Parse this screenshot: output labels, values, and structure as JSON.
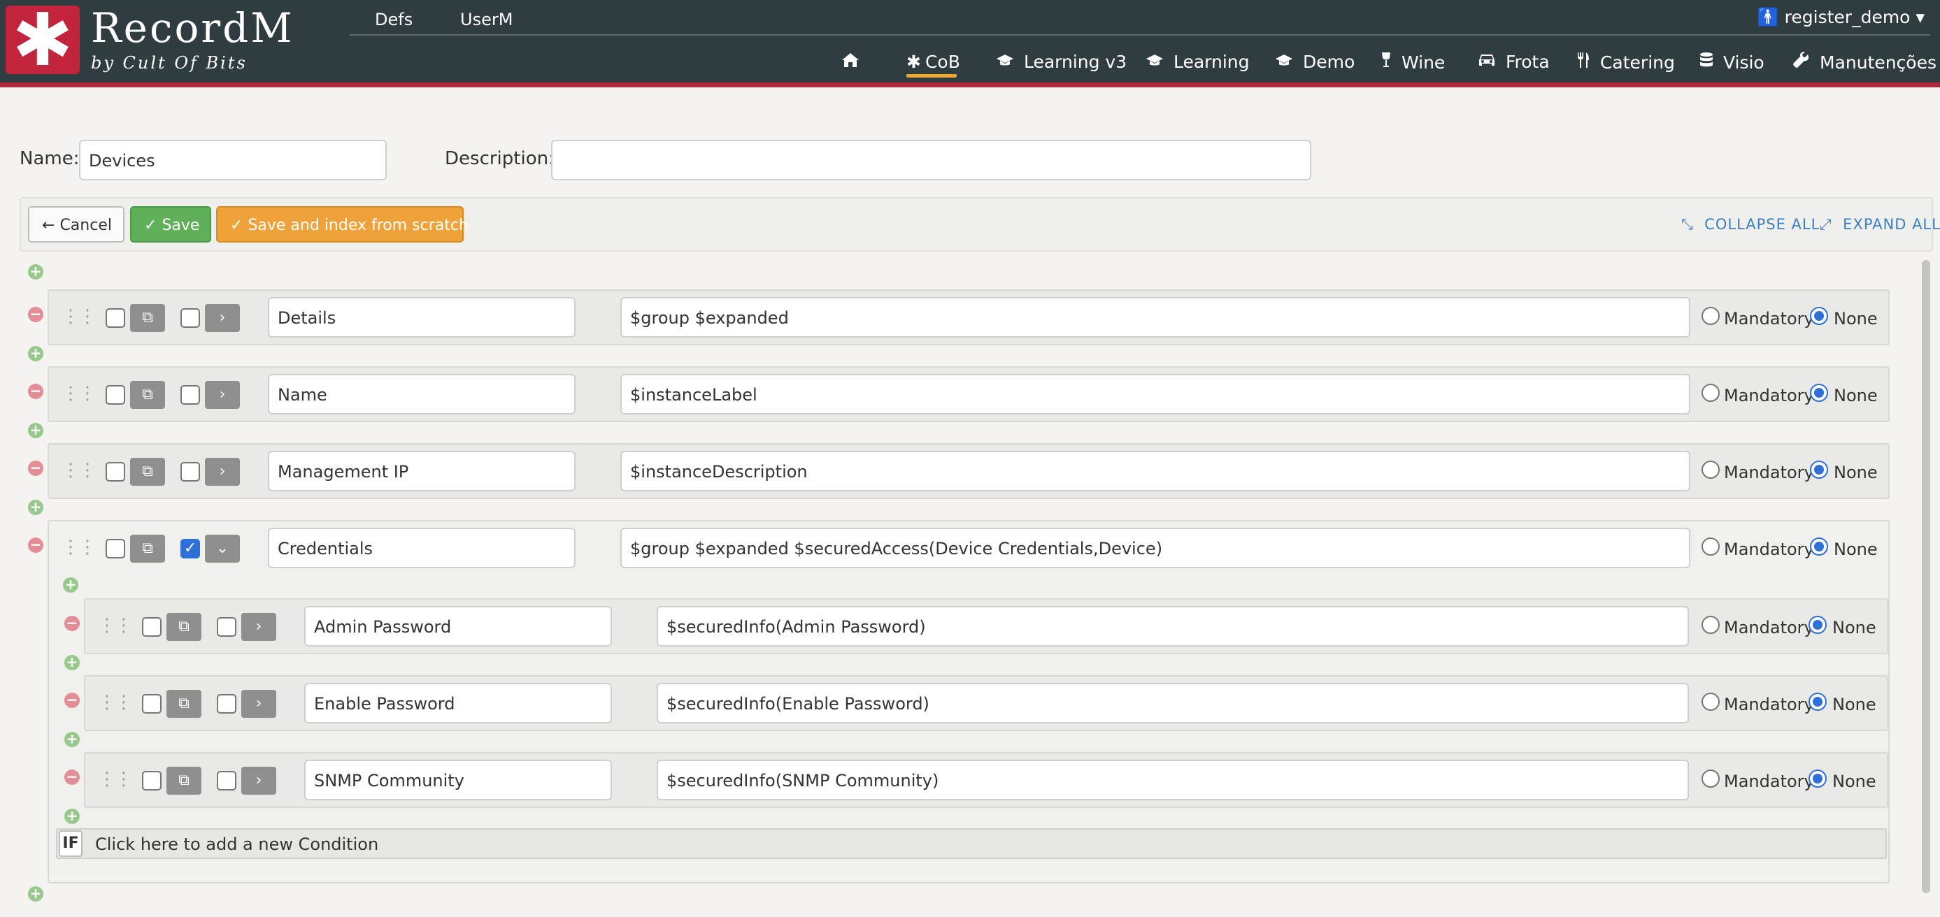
{
  "app": {
    "logo_glyph": "✱",
    "name": "RecordM",
    "tagline": "by Cult Of Bits"
  },
  "subnav": [
    "Defs",
    "UserM"
  ],
  "user": {
    "name": "register_demo",
    "caret": "▾"
  },
  "mainnav": [
    {
      "icon": "home-icon",
      "label": ""
    },
    {
      "icon": "asterisk-icon",
      "label": "CoB",
      "active": true
    },
    {
      "icon": "graduation-cap-icon",
      "label": "Learning v3"
    },
    {
      "icon": "graduation-cap-icon",
      "label": "Learning"
    },
    {
      "icon": "graduation-cap-icon",
      "label": "Demo"
    },
    {
      "icon": "wine-glass-icon",
      "label": "Wine"
    },
    {
      "icon": "car-icon",
      "label": "Frota"
    },
    {
      "icon": "utensils-icon",
      "label": "Catering"
    },
    {
      "icon": "database-icon",
      "label": "Visio"
    },
    {
      "icon": "wrench-icon",
      "label": "Manutenções"
    }
  ],
  "form": {
    "name_label": "Name:",
    "name_value": "Devices",
    "description_label": "Description:",
    "description_value": ""
  },
  "toolbar": {
    "cancel": "Cancel",
    "save": "Save",
    "save_index": "Save and index from scratch",
    "collapse_all": "COLLAPSE ALL",
    "expand_all": "EXPAND ALL"
  },
  "fields": [
    {
      "name": "Details",
      "description": "$group $expanded",
      "expanded": false,
      "mandatory": false
    },
    {
      "name": "Name",
      "description": "$instanceLabel",
      "expanded": false,
      "mandatory": false
    },
    {
      "name": "Management IP",
      "description": "$instanceDescription",
      "expanded": false,
      "mandatory": false
    },
    {
      "name": "Credentials",
      "description": "$group $expanded $securedAccess(Device Credentials,Device)",
      "expanded": true,
      "mandatory": false
    },
    {
      "name": "Admin Password",
      "description": "$securedInfo(Admin Password)",
      "expanded": false,
      "mandatory": false,
      "child": true
    },
    {
      "name": "Enable Password",
      "description": "$securedInfo(Enable Password)",
      "expanded": false,
      "mandatory": false,
      "child": true
    },
    {
      "name": "SNMP Community",
      "description": "$securedInfo(SNMP Community)",
      "expanded": false,
      "mandatory": false,
      "child": true
    }
  ],
  "radio_labels": {
    "mandatory": "Mandatory",
    "none": "None"
  },
  "condition": {
    "tag": "IF",
    "text": "Click here to add a new Condition"
  },
  "colors": {
    "topbar": "#2f3c40",
    "brand_red": "#c2253b",
    "accent_orange": "#f0a830",
    "save_green": "#5fb058",
    "link_blue": "#3a7fc1"
  }
}
